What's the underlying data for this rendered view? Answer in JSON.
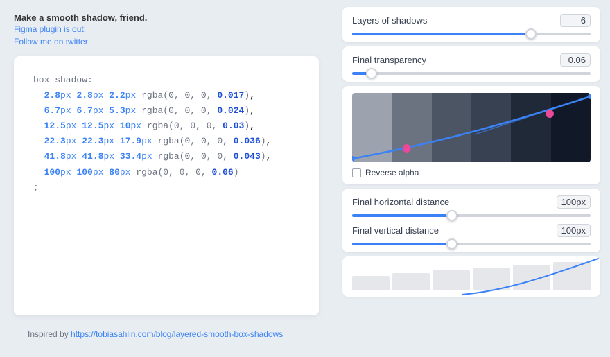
{
  "header": {
    "tagline": "Make a smooth shadow, friend.",
    "figma_link_text": "Figma plugin is out!",
    "figma_link_url": "#",
    "twitter_link_text": "Follow me on twitter",
    "twitter_link_url": "#"
  },
  "code": {
    "lines": [
      {
        "indent": "  ",
        "x": "2.8",
        "y": "2.8",
        "blur": "2.2",
        "spread": "",
        "r": "0",
        "g": "0",
        "b": "0",
        "a": "0.017"
      },
      {
        "indent": "  ",
        "x": "6.7",
        "y": "6.7",
        "blur": "5.3",
        "spread": "",
        "r": "0",
        "g": "0",
        "b": "0",
        "a": "0.024"
      },
      {
        "indent": "  ",
        "x": "12.5",
        "y": "12.5",
        "blur": "10",
        "spread": "",
        "r": "0",
        "g": "0",
        "b": "0",
        "a": "0.03"
      },
      {
        "indent": "  ",
        "x": "22.3",
        "y": "22.3",
        "blur": "17.9",
        "spread": "",
        "r": "0",
        "g": "0",
        "b": "0",
        "a": "0.036"
      },
      {
        "indent": "  ",
        "x": "41.8",
        "y": "41.8",
        "blur": "33.4",
        "spread": "",
        "r": "0",
        "g": "0",
        "b": "0",
        "a": "0.043"
      },
      {
        "indent": "  ",
        "x": "100",
        "y": "100",
        "blur": "80",
        "spread": "",
        "r": "0",
        "g": "0",
        "b": "0",
        "a": "0.06"
      }
    ]
  },
  "controls": {
    "layers": {
      "label": "Layers of shadows",
      "value": "6",
      "slider_pct": 75
    },
    "transparency": {
      "label": "Final transparency",
      "value": "0.06",
      "slider_pct": 8
    },
    "reverse_alpha": {
      "label": "Reverse alpha",
      "checked": false
    },
    "horizontal": {
      "label": "Final horizontal distance",
      "value": "100px",
      "slider_pct": 42
    },
    "vertical": {
      "label": "Final vertical distance",
      "value": "100px",
      "slider_pct": 42
    }
  },
  "footer": {
    "text": "Inspired by ",
    "link_text": "https://tobiasahlin.com/blog/layered-smooth-box-shadows",
    "link_url": "https://tobiasahlin.com/blog/layered-smooth-box-shadows"
  },
  "colors": {
    "accent": "#3b82f6",
    "control_point_pink": "#ec4899",
    "control_point_blue": "#3b82f6"
  }
}
